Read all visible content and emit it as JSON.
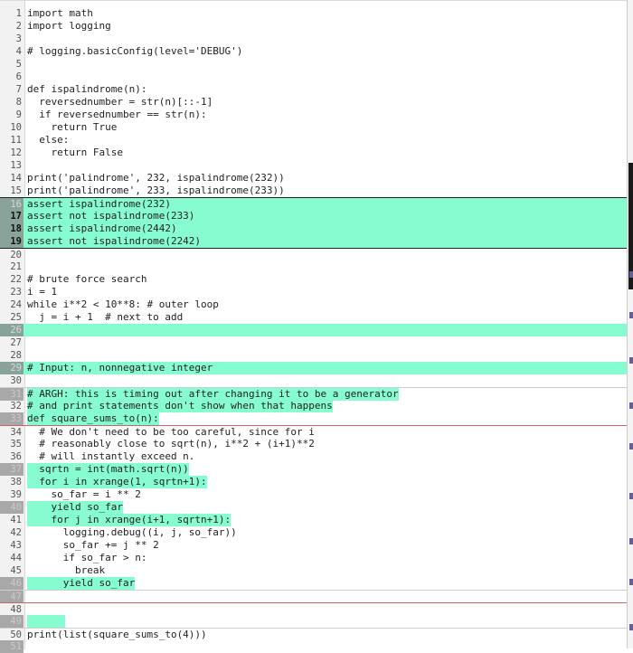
{
  "editor": {
    "lines": [
      {
        "n": "1",
        "code": "import math"
      },
      {
        "n": "2",
        "code": "import logging"
      },
      {
        "n": "3",
        "code": ""
      },
      {
        "n": "4",
        "code": "# logging.basicConfig(level='DEBUG')"
      },
      {
        "n": "5",
        "code": ""
      },
      {
        "n": "6",
        "code": ""
      },
      {
        "n": "7",
        "code": "def ispalindrome(n):"
      },
      {
        "n": "8",
        "code": "  reversednumber = str(n)[::-1]"
      },
      {
        "n": "9",
        "code": "  if reversednumber == str(n):"
      },
      {
        "n": "10",
        "code": "    return True"
      },
      {
        "n": "11",
        "code": "  else:"
      },
      {
        "n": "12",
        "code": "    return False"
      },
      {
        "n": "13",
        "code": ""
      },
      {
        "n": "14",
        "code": "print('palindrome', 232, ispalindrome(232))"
      },
      {
        "n": "15",
        "code": "print('palindrome', 233, ispalindrome(233))"
      },
      {
        "n": "16",
        "code": "assert ispalindrome(232)"
      },
      {
        "n": "17",
        "code": "assert not ispalindrome(233)"
      },
      {
        "n": "18",
        "code": "assert ispalindrome(2442)"
      },
      {
        "n": "19",
        "code": "assert not ispalindrome(2242)"
      },
      {
        "n": "20",
        "code": ""
      },
      {
        "n": "21",
        "code": ""
      },
      {
        "n": "22",
        "code": "# brute force search"
      },
      {
        "n": "23",
        "code": "i = 1"
      },
      {
        "n": "24",
        "code": "while i**2 < 10**8: # outer loop"
      },
      {
        "n": "25",
        "code": "  j = i + 1  # next to add"
      },
      {
        "n": "26",
        "code": ""
      },
      {
        "n": "27",
        "code": ""
      },
      {
        "n": "28",
        "code": ""
      },
      {
        "n": "29",
        "code": "# Input: n, nonnegative integer"
      },
      {
        "n": "30",
        "code": ""
      },
      {
        "n": "31",
        "code": "# ARGH: this is timing out after changing it to be a generator"
      },
      {
        "n": "32",
        "code": "# and print statements don't show when that happens"
      },
      {
        "n": "33",
        "code": "def square_sums_to(n):"
      },
      {
        "n": "34",
        "code": "  # We don't need to be too careful, since for i"
      },
      {
        "n": "35",
        "code": "  # reasonably close to sqrt(n), i**2 + (i+1)**2"
      },
      {
        "n": "36",
        "code": "  # will instantly exceed n."
      },
      {
        "n": "37",
        "code": "  sqrtn = int(math.sqrt(n))"
      },
      {
        "n": "38",
        "code": "  for i in xrange(1, sqrtn+1):"
      },
      {
        "n": "39",
        "code": "    so_far = i ** 2"
      },
      {
        "n": "40",
        "code": "    yield so_far"
      },
      {
        "n": "41",
        "code": "    for j in xrange(i+1, sqrtn+1):"
      },
      {
        "n": "42",
        "code": "      logging.debug((i, j, so_far))"
      },
      {
        "n": "43",
        "code": "      so_far += j ** 2"
      },
      {
        "n": "44",
        "code": "      if so_far > n:"
      },
      {
        "n": "45",
        "code": "        break"
      },
      {
        "n": "46",
        "code": "      yield so_far"
      },
      {
        "n": "47",
        "code": ""
      },
      {
        "n": "48",
        "code": ""
      },
      {
        "n": "49",
        "code": ""
      },
      {
        "n": "50",
        "code": "print(list(square_sums_to(4)))"
      },
      {
        "n": "51",
        "code": ""
      }
    ]
  },
  "colors": {
    "highlight": "#86fcd0",
    "scroll_thumb": "#1a1a1a",
    "scroll_mark": "#6a5d9a"
  }
}
